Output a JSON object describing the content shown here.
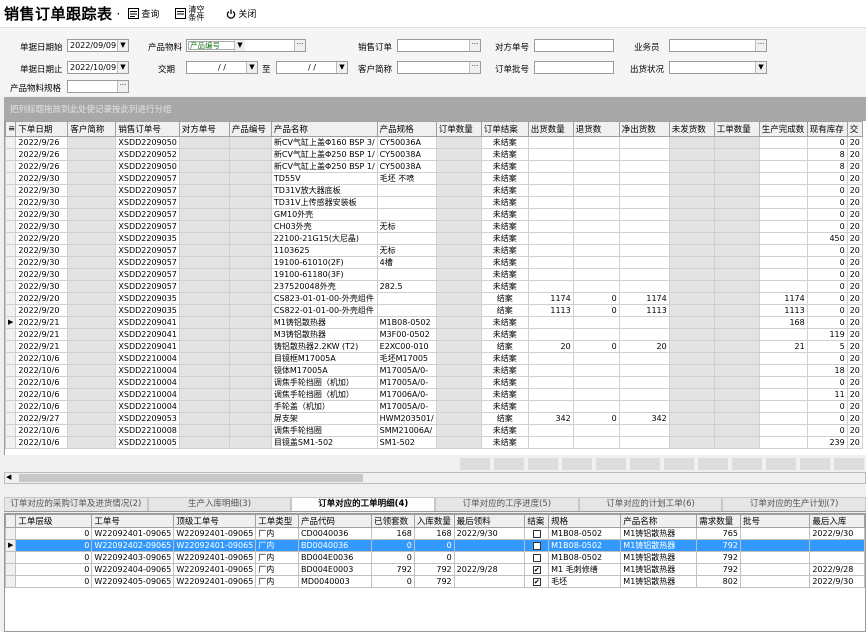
{
  "app": {
    "title": "销售订单跟踪表",
    "separator": "·",
    "toolbar": [
      {
        "id": "query",
        "label": "查询",
        "icon": "query-icon"
      },
      {
        "id": "clear",
        "label": "清空条件",
        "icon": "clear-icon"
      },
      {
        "id": "close",
        "label": "关闭",
        "icon": "power-icon"
      }
    ]
  },
  "filters": {
    "date_from_label": "单据日期始",
    "date_from": "2022/09/09",
    "date_to_label": "单据日期止",
    "date_to": "2022/10/09",
    "product_label": "产品物料",
    "product_mode": "产品编号",
    "period_label": "交期",
    "period_from": "/ /",
    "period_to_label": "至",
    "period_to": "/ /",
    "order_label": "销售订单",
    "customer_label": "客户简称",
    "other_no_label": "对方单号",
    "batch_label": "订单批号",
    "salesman_label": "业务员",
    "ship_status_label": "出货状况",
    "spec_label": "产品物料规格"
  },
  "group_hint": "把列标题拖放到此处使记录按此列进行分组",
  "main_grid": {
    "columns": [
      "下单日期",
      "客户简称",
      "销售订单号",
      "对方单号",
      "产品编号",
      "产品名称",
      "产品规格",
      "订单数量",
      "订单结案",
      "出货数量",
      "退货数",
      "净出货数",
      "未发货数",
      "工单数量",
      "生产完成数",
      "现有库存",
      "交"
    ],
    "rows": [
      [
        "2022/9/26",
        "",
        "XSDD2209050",
        "",
        "",
        "新CV气缸上盖Φ160 BSP 3/",
        "CY50036A",
        "",
        "未结案",
        "",
        "",
        "",
        "",
        "",
        "",
        "0",
        "20"
      ],
      [
        "2022/9/26",
        "",
        "XSDD2209052",
        "",
        "",
        "新CV气缸上盖Φ250 BSP 1/",
        "CY50038A",
        "",
        "未结案",
        "",
        "",
        "",
        "",
        "",
        "",
        "8",
        "20"
      ],
      [
        "2022/9/26",
        "",
        "XSDD2209050",
        "",
        "",
        "新CV气缸上盖Φ250 BSP 1/",
        "CY50038A",
        "",
        "未结案",
        "",
        "",
        "",
        "",
        "",
        "",
        "8",
        "20"
      ],
      [
        "2022/9/30",
        "",
        "XSDD2209057",
        "",
        "",
        "TD55V",
        "毛坯 不喷",
        "",
        "未结案",
        "",
        "",
        "",
        "",
        "",
        "",
        "0",
        "20"
      ],
      [
        "2022/9/30",
        "",
        "XSDD2209057",
        "",
        "",
        "TD31V放大器底板",
        "",
        "",
        "未结案",
        "",
        "",
        "",
        "",
        "",
        "",
        "0",
        "20"
      ],
      [
        "2022/9/30",
        "",
        "XSDD2209057",
        "",
        "",
        "TD31V上传感器安装板",
        "",
        "",
        "未结案",
        "",
        "",
        "",
        "",
        "",
        "",
        "0",
        "20"
      ],
      [
        "2022/9/30",
        "",
        "XSDD2209057",
        "",
        "",
        "GM10外壳",
        "",
        "",
        "未结案",
        "",
        "",
        "",
        "",
        "",
        "",
        "0",
        "20"
      ],
      [
        "2022/9/30",
        "",
        "XSDD2209057",
        "",
        "",
        "CH03外壳",
        "无标",
        "",
        "未结案",
        "",
        "",
        "",
        "",
        "",
        "",
        "0",
        "20"
      ],
      [
        "2022/9/20",
        "",
        "XSDD2209035",
        "",
        "",
        "22100-21G15(大尼晶)",
        "",
        "",
        "未结案",
        "",
        "",
        "",
        "",
        "",
        "",
        "450",
        "20"
      ],
      [
        "2022/9/30",
        "",
        "XSDD2209057",
        "",
        "",
        "1103625",
        "无标",
        "",
        "未结案",
        "",
        "",
        "",
        "",
        "",
        "",
        "0",
        "20"
      ],
      [
        "2022/9/30",
        "",
        "XSDD2209057",
        "",
        "",
        "19100-61010(2F)",
        "4槽",
        "",
        "未结案",
        "",
        "",
        "",
        "",
        "",
        "",
        "0",
        "20"
      ],
      [
        "2022/9/30",
        "",
        "XSDD2209057",
        "",
        "",
        "19100-61180(3F)",
        "",
        "",
        "未结案",
        "",
        "",
        "",
        "",
        "",
        "",
        "0",
        "20"
      ],
      [
        "2022/9/30",
        "",
        "XSDD2209057",
        "",
        "",
        "237520048外壳",
        "282.5",
        "",
        "未结案",
        "",
        "",
        "",
        "",
        "",
        "",
        "0",
        "20"
      ],
      [
        "2022/9/20",
        "",
        "XSDD2209035",
        "",
        "",
        "CS823-01-01-00-外壳组件",
        "",
        "",
        "结案",
        "1174",
        "0",
        "1174",
        "",
        "",
        "1174",
        "0",
        "20"
      ],
      [
        "2022/9/20",
        "",
        "XSDD2209035",
        "",
        "",
        "CS822-01-01-00-外壳组件",
        "",
        "",
        "结案",
        "1113",
        "0",
        "1113",
        "",
        "",
        "1113",
        "0",
        "20"
      ],
      [
        "2022/9/21",
        "",
        "XSDD2209041",
        "",
        "",
        "M1铸铝散热器",
        "M1B08-0502",
        "",
        "未结案",
        "",
        "",
        "",
        "",
        "",
        "168",
        "0",
        "20"
      ],
      [
        "2022/9/21",
        "",
        "XSDD2209041",
        "",
        "",
        "M3铸铝散热器",
        "M3F00-0502",
        "",
        "未结案",
        "",
        "",
        "",
        "",
        "",
        "",
        "119",
        "20"
      ],
      [
        "2022/9/21",
        "",
        "XSDD2209041",
        "",
        "",
        "铸铝散热器2.2KW (T2)",
        "E2XC00-010",
        "",
        "结案",
        "20",
        "0",
        "20",
        "",
        "",
        "21",
        "5",
        "20"
      ],
      [
        "2022/10/6",
        "",
        "XSDD2210004",
        "",
        "",
        "目镜框M17005A",
        "毛坯M17005",
        "",
        "未结案",
        "",
        "",
        "",
        "",
        "",
        "",
        "0",
        "20"
      ],
      [
        "2022/10/6",
        "",
        "XSDD2210004",
        "",
        "",
        "镜体M17005A",
        "M17005A/0-",
        "",
        "未结案",
        "",
        "",
        "",
        "",
        "",
        "",
        "18",
        "20"
      ],
      [
        "2022/10/6",
        "",
        "XSDD2210004",
        "",
        "",
        "调焦手轮挡圈（机加）",
        "M17005A/0-",
        "",
        "未结案",
        "",
        "",
        "",
        "",
        "",
        "",
        "0",
        "20"
      ],
      [
        "2022/10/6",
        "",
        "XSDD2210004",
        "",
        "",
        "调焦手轮挡圈（机加）",
        "M17006A/0-",
        "",
        "未结案",
        "",
        "",
        "",
        "",
        "",
        "",
        "11",
        "20"
      ],
      [
        "2022/10/6",
        "",
        "XSDD2210004",
        "",
        "",
        "手轮盖（机加）",
        "M17005A/0-",
        "",
        "未结案",
        "",
        "",
        "",
        "",
        "",
        "",
        "0",
        "20"
      ],
      [
        "2022/9/27",
        "",
        "XSDD2209053",
        "",
        "",
        "屏支架",
        "HWM203501/",
        "",
        "结案",
        "342",
        "0",
        "342",
        "",
        "",
        "",
        "0",
        "20"
      ],
      [
        "2022/10/6",
        "",
        "XSDD2210008",
        "",
        "",
        "调焦手轮挡圈",
        "SMM21006A/",
        "",
        "未结案",
        "",
        "",
        "",
        "",
        "",
        "",
        "0",
        "20"
      ],
      [
        "2022/10/6",
        "",
        "XSDD2210005",
        "",
        "",
        "目镜盖SM1-502",
        "SM1-502",
        "",
        "未结案",
        "",
        "",
        "",
        "",
        "",
        "",
        "239",
        "20"
      ]
    ],
    "selected_row": 15
  },
  "tabs": [
    {
      "label": "订单对应的采购订单及进货情况(2)",
      "active": false
    },
    {
      "label": "生产入库明细(3)",
      "active": false
    },
    {
      "label": "订单对应的工单明细(4)",
      "active": true
    },
    {
      "label": "订单对应的工序进度(5)",
      "active": false
    },
    {
      "label": "订单对应的计划工单(6)",
      "active": false
    },
    {
      "label": "订单对应的生产计划(7)",
      "active": false
    }
  ],
  "detail_grid": {
    "columns": [
      "工单层级",
      "工单号",
      "顶级工单号",
      "工单类型",
      "产品代码",
      "已领套数",
      "入库数量",
      "最后领料",
      "结案",
      "规格",
      "产品名称",
      "需求数量",
      "批号",
      "最后入库"
    ],
    "rows": [
      [
        "0",
        "W22092401-09065",
        "W22092401-09065",
        "厂内",
        "CD0040036",
        "168",
        "168",
        "2022/9/30",
        false,
        "M1B08-0502",
        "M1铸铝散热器",
        "765",
        "",
        "2022/9/30"
      ],
      [
        "0",
        "W22092402-09065",
        "W22092401-09065",
        "厂内",
        "BD0040036",
        "0",
        "0",
        "",
        false,
        "M1B08-0502",
        "M1铸铝散热器",
        "792",
        "",
        ""
      ],
      [
        "0",
        "W22092403-09065",
        "W22092401-09065",
        "厂内",
        "BD004E0036",
        "0",
        "0",
        "",
        false,
        "M1B08-0502",
        "M1铸铝散热器",
        "792",
        "",
        ""
      ],
      [
        "0",
        "W22092404-09065",
        "W22092401-09065",
        "厂内",
        "BD004E0003",
        "792",
        "792",
        "2022/9/28",
        true,
        "M1 毛刺修缮",
        "M1铸铝散热器",
        "792",
        "",
        "2022/9/28"
      ],
      [
        "0",
        "W22092405-09065",
        "W22092401-09065",
        "厂内",
        "MD0040003",
        "0",
        "792",
        "",
        true,
        "毛坯",
        "M1铸铝散热器",
        "802",
        "",
        "2022/9/30"
      ]
    ],
    "selected_row": 1
  }
}
